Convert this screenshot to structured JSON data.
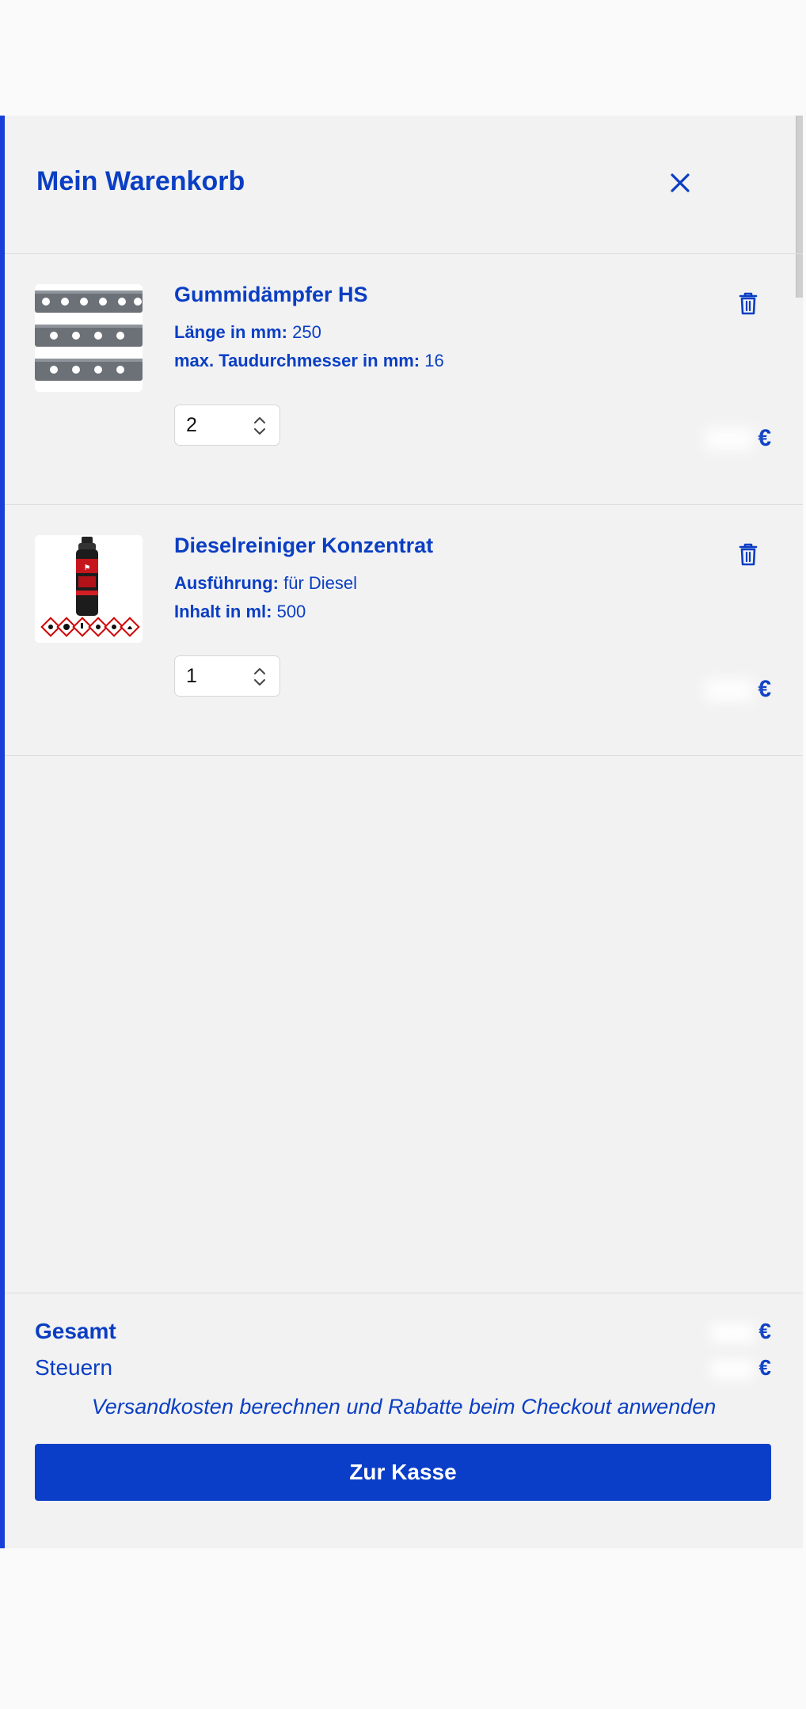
{
  "cart": {
    "title": "Mein Warenkorb",
    "items": [
      {
        "name": "Gummidämpfer HS",
        "attributes": [
          {
            "key": "Länge in mm:",
            "value": "250"
          },
          {
            "key": "max. Taudurchmesser in mm:",
            "value": "16"
          }
        ],
        "quantity": "2",
        "price_currency": "€"
      },
      {
        "name": "Dieselreiniger Konzentrat",
        "attributes": [
          {
            "key": "Ausführung:",
            "value": "für Diesel"
          },
          {
            "key": "Inhalt in ml:",
            "value": "500"
          }
        ],
        "quantity": "1",
        "price_currency": "€"
      }
    ]
  },
  "summary": {
    "total_label": "Gesamt",
    "total_currency": "€",
    "tax_label": "Steuern",
    "tax_currency": "€",
    "shipping_note": "Versandkosten berechnen und Rabatte beim Checkout anwenden",
    "checkout_label": "Zur Kasse"
  },
  "colors": {
    "accent": "#0a3ec3",
    "button": "#0a3ec8",
    "panel": "#f2f2f2"
  },
  "icons": {
    "close": "close-icon",
    "delete": "trash-icon",
    "quantity": "chevron-updown-icon"
  }
}
